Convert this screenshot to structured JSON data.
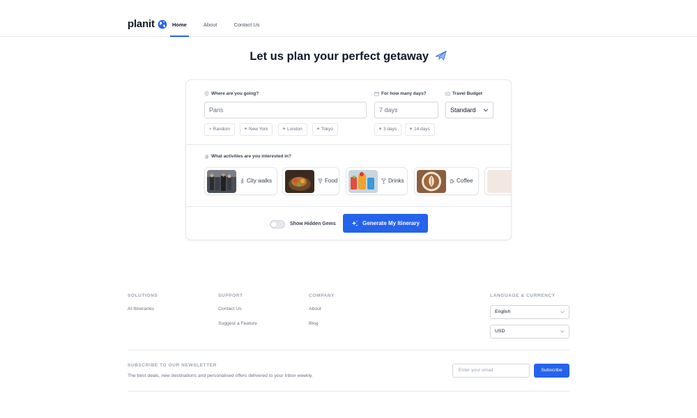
{
  "header": {
    "logo_text": "planit",
    "nav": [
      {
        "label": "Home",
        "active": true
      },
      {
        "label": "About",
        "active": false
      },
      {
        "label": "Contact Us",
        "active": false
      }
    ]
  },
  "hero": {
    "title": "Let us plan your perfect getaway"
  },
  "planner": {
    "destination": {
      "label": "Where are you going?",
      "placeholder": "Paris",
      "suggestions": [
        "Random",
        "New York",
        "London",
        "Tokyo"
      ]
    },
    "days": {
      "label": "For how many days?",
      "placeholder": "7 days",
      "suggestions": [
        "3 days",
        "14 days"
      ]
    },
    "budget": {
      "label": "Travel Budget",
      "value": "Standard"
    },
    "activities": {
      "label": "What activities are you interested in?",
      "items": [
        {
          "label": "City walks",
          "icon": "walking-icon"
        },
        {
          "label": "Food",
          "icon": "food-icon"
        },
        {
          "label": "Drinks",
          "icon": "cocktail-icon"
        },
        {
          "label": "Coffee",
          "icon": "coffee-icon"
        }
      ]
    },
    "hidden_gems": {
      "label": "Show Hidden Gems",
      "enabled": false
    },
    "generate_label": "Generate My Itinerary"
  },
  "footer": {
    "columns": [
      {
        "title": "SOLUTIONS",
        "links": [
          "AI Itineraries"
        ]
      },
      {
        "title": "SUPPORT",
        "links": [
          "Contact Us",
          "Suggest a Feature"
        ]
      },
      {
        "title": "COMPANY",
        "links": [
          "About",
          "Blog"
        ]
      }
    ],
    "language_currency": {
      "title": "LANGUAGE & CURRENCY",
      "language": "English",
      "currency": "USD"
    },
    "newsletter": {
      "title": "SUBSCRIBE TO OUR NEWSLETTER",
      "description": "The best deals, new destinations and personalised offers delivered to your inbox weekly.",
      "email_placeholder": "Enter your email",
      "button_label": "Subscribe"
    }
  },
  "colors": {
    "accent": "#2563eb",
    "border": "#e5e7eb",
    "muted": "#6b7280"
  }
}
